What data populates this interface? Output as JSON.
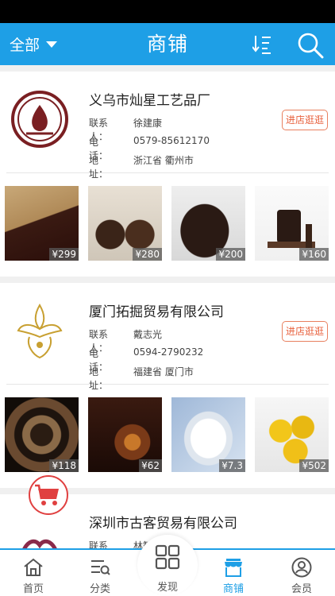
{
  "header": {
    "filter_label": "全部",
    "title": "商铺"
  },
  "labels": {
    "contact": "联系人：",
    "phone": "电　　话：",
    "address": "地　　址：",
    "enter_button": "进店逛逛"
  },
  "shops": [
    {
      "name": "义乌市灿星工艺品厂",
      "contact": "徐建康",
      "phone": "0579-85612170",
      "address": "浙江省 衢州市",
      "products": [
        {
          "price": "¥299"
        },
        {
          "price": "¥280"
        },
        {
          "price": "¥200"
        },
        {
          "price": "¥160"
        }
      ]
    },
    {
      "name": "厦门拓掘贸易有限公司",
      "contact": "戴志光",
      "phone": "0594-2790232",
      "address": "福建省 厦门市",
      "products": [
        {
          "price": "¥118"
        },
        {
          "price": "¥62"
        },
        {
          "price": "¥7.3"
        },
        {
          "price": "¥502"
        }
      ]
    },
    {
      "name": "深圳市古客贸易有限公司",
      "contact": "林智龙"
    }
  ],
  "tabs": [
    {
      "label": "首页",
      "icon": "home-icon"
    },
    {
      "label": "分类",
      "icon": "category-icon"
    },
    {
      "label": "发现",
      "icon": "discover-icon"
    },
    {
      "label": "商铺",
      "icon": "shop-icon"
    },
    {
      "label": "会员",
      "icon": "member-icon"
    }
  ],
  "colors": {
    "primary": "#1e9fe6",
    "accent": "#e8603c"
  }
}
